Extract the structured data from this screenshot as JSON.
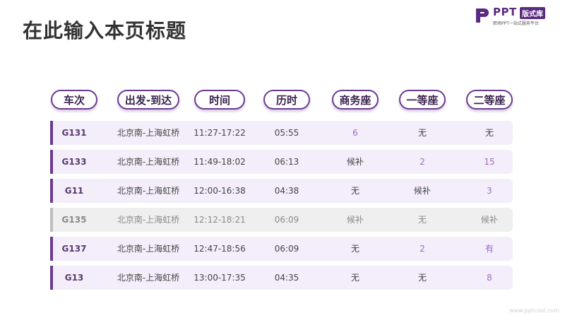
{
  "title": "在此输入本页标题",
  "logo": {
    "brand": "PPT",
    "badge": "版式库",
    "subtitle": "职场PPT一站式服务平台"
  },
  "columns": [
    "车次",
    "出发-到达",
    "时间",
    "历时",
    "商务座",
    "一等座",
    "二等座"
  ],
  "rows": [
    {
      "train": "G131",
      "route": "北京南-上海虹桥",
      "time": "11:27-17:22",
      "duration": "05:55",
      "business": "6",
      "first": "无",
      "second": "无",
      "style": "normal"
    },
    {
      "train": "G133",
      "route": "北京南-上海虹桥",
      "time": "11:49-18:02",
      "duration": "06:13",
      "business": "候补",
      "first": "2",
      "second": "15",
      "style": "normal"
    },
    {
      "train": "G11",
      "route": "北京南-上海虹桥",
      "time": "12:00-16:38",
      "duration": "04:38",
      "business": "无",
      "first": "候补",
      "second": "3",
      "style": "normal"
    },
    {
      "train": "G135",
      "route": "北京南-上海虹桥",
      "time": "12:12-18:21",
      "duration": "06:09",
      "business": "候补",
      "first": "无",
      "second": "候补",
      "style": "grey"
    },
    {
      "train": "G137",
      "route": "北京南-上海虹桥",
      "time": "12:47-18:56",
      "duration": "06:09",
      "business": "无",
      "first": "2",
      "second": "有",
      "style": "normal"
    },
    {
      "train": "G13",
      "route": "北京南-上海虹桥",
      "time": "13:00-17:35",
      "duration": "04:35",
      "business": "无",
      "first": "无",
      "second": "8",
      "style": "normal"
    }
  ],
  "colors": {
    "accent": "#6d3a93",
    "row_bg": "#f4eefa",
    "grey_row_bg": "#efefef",
    "number_color": "#9b6bc0"
  },
  "footer": "www.pptcool.com"
}
